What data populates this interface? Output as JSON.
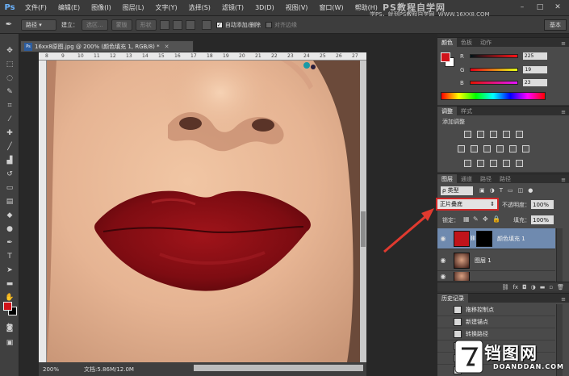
{
  "app": {
    "logo": "Ps",
    "menu": [
      "文件(F)",
      "编辑(E)",
      "图像(I)",
      "图层(L)",
      "文字(Y)",
      "选择(S)",
      "滤镜(T)",
      "3D(D)",
      "视图(V)",
      "窗口(W)",
      "帮助(H)"
    ],
    "watermark_title": "PS教程自学网",
    "watermark_sub": "学PS，就到PS教程自学网",
    "watermark_url": "WWW.16XX8.COM"
  },
  "options": {
    "mode_select": "路径",
    "make_label": "建立：",
    "selection_btn": "选区...",
    "mask_btn": "蒙版",
    "shape_btn": "形状",
    "auto_add_delete": "自动添加/删除",
    "align_edges": "对齐边缘",
    "workspace": "基本"
  },
  "document": {
    "tab_title": "16xx8原图.jpg @ 200% (颜色填充 1, RGB/8) *",
    "ruler_numbers": [
      "8",
      "9",
      "10",
      "11",
      "12",
      "13",
      "14",
      "15",
      "16",
      "17",
      "18",
      "19",
      "20",
      "21",
      "22",
      "23",
      "24",
      "25",
      "26",
      "27"
    ],
    "zoom": "200%",
    "doc_size": "文档:5.86M/12.0M"
  },
  "color_panel": {
    "tabs": [
      "颜色",
      "色板",
      "动作"
    ],
    "channels": [
      {
        "label": "R",
        "value": "225"
      },
      {
        "label": "G",
        "value": "19"
      },
      {
        "label": "B",
        "value": "23"
      }
    ],
    "foreground": "#d0131a"
  },
  "adjustments_panel": {
    "tabs": [
      "调整",
      "样式"
    ],
    "title": "添加调整"
  },
  "layers_panel": {
    "tabs": [
      "图层",
      "通道",
      "路径",
      "路径"
    ],
    "kind_filter": "ρ 类型",
    "blend_mode": "正片叠底",
    "opacity_label": "不透明度：",
    "opacity_value": "100%",
    "lock_label": "锁定：",
    "fill_label": "填充：",
    "fill_value": "100%",
    "layers": [
      {
        "name": "颜色填充 1",
        "selected": true
      },
      {
        "name": "图层 1",
        "selected": false
      },
      {
        "name": "",
        "selected": false
      }
    ]
  },
  "history_panel": {
    "tab": "历史记录",
    "items": [
      "拖移控制点",
      "新建锚点",
      "转换路径",
      "",
      "",
      "",
      ""
    ]
  },
  "site_watermark": {
    "name": "铛图网",
    "url": "DOANDDAN.COM"
  }
}
